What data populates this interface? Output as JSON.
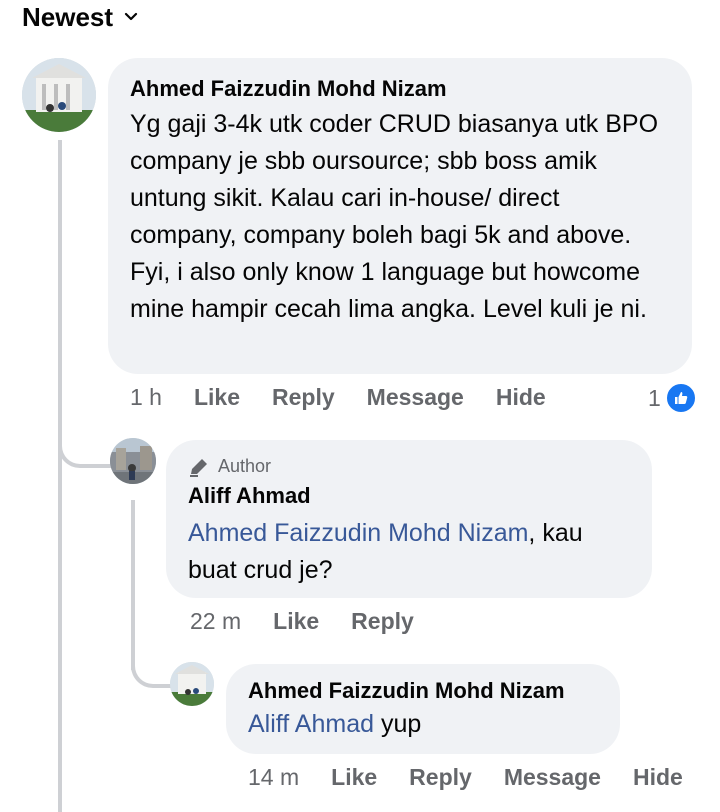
{
  "sort": {
    "label": "Newest"
  },
  "comments": [
    {
      "author": "Ahmed Faizzudin Mohd Nizam",
      "text": "Yg gaji 3-4k utk coder CRUD biasanya utk BPO company je sbb oursource; sbb boss amik untung sikit. Kalau cari in-house/ direct company, company boleh bagi 5k and above. Fyi, i also only know 1 language but howcome mine hampir cecah lima angka. Level kuli je ni.",
      "time": "1 h",
      "actions": [
        "Like",
        "Reply",
        "Message",
        "Hide"
      ],
      "reaction_count": "1"
    },
    {
      "badge": "Author",
      "author": "Aliff Ahmad",
      "mention": "Ahmed Faizzudin Mohd Nizam",
      "text": ", kau buat crud je?",
      "time": "22 m",
      "actions": [
        "Like",
        "Reply"
      ]
    },
    {
      "author": "Ahmed Faizzudin Mohd Nizam",
      "mention": "Aliff Ahmad",
      "text": " yup",
      "time": "14 m",
      "actions": [
        "Like",
        "Reply",
        "Message",
        "Hide"
      ]
    }
  ],
  "colors": {
    "link": "#385898",
    "bubble": "#f0f2f5",
    "like_blue": "#1877f2",
    "meta": "#65676b"
  }
}
